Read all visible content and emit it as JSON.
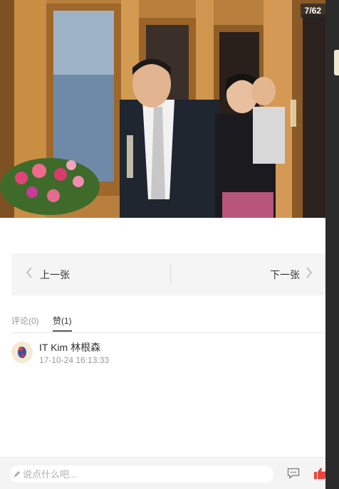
{
  "photo": {
    "counter": "7/62",
    "description_icon": "event-photo"
  },
  "pager": {
    "prev_label": "上一张",
    "next_label": "下一张",
    "prev_icon": "chevron-left-icon",
    "next_icon": "chevron-right-icon"
  },
  "tabs": {
    "comments": "评论(0)",
    "likes": "赞(1)",
    "active": "likes"
  },
  "likes": [
    {
      "name": "IT Kim 林根森",
      "time": "17-10-24 16:13:33"
    }
  ],
  "bottom_bar": {
    "comment_placeholder": "说点什么吧...",
    "comment_icon": "comment-icon",
    "like_icon": "thumbs-up-icon"
  },
  "colors": {
    "like_accent": "#e8463c",
    "pager_bg": "#f5f5f5"
  }
}
